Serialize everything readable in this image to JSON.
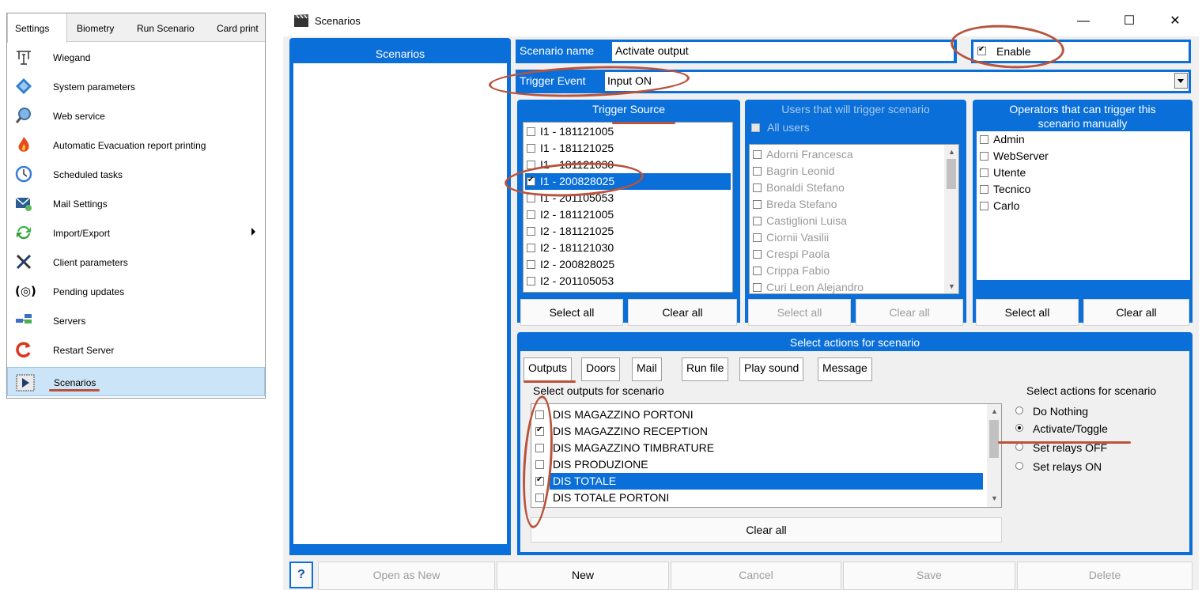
{
  "menu": {
    "tabs": [
      "Settings",
      "Biometry",
      "Run Scenario",
      "Card print"
    ],
    "items": [
      {
        "label": "Wiegand",
        "icon": "wiegand-icon"
      },
      {
        "label": "System parameters",
        "icon": "diamond-icon"
      },
      {
        "label": "Web service",
        "icon": "magnifier-globe-icon"
      },
      {
        "label": "Automatic Evacuation report printing",
        "icon": "flame-icon"
      },
      {
        "label": "Scheduled tasks",
        "icon": "clock-icon"
      },
      {
        "label": "Mail Settings",
        "icon": "mail-icon"
      },
      {
        "label": "Import/Export",
        "icon": "sync-arrows-icon"
      },
      {
        "label": "Client parameters",
        "icon": "tools-icon"
      },
      {
        "label": "Pending updates",
        "icon": "pending-icon"
      },
      {
        "label": "Servers",
        "icon": "servers-icon"
      },
      {
        "label": "Restart Server",
        "icon": "restart-icon"
      },
      {
        "label": "Scenarios",
        "icon": "play-icon"
      }
    ]
  },
  "window": {
    "title": "Scenarios",
    "controls": {
      "minimize": "—",
      "maximize": "☐",
      "close": "✕"
    }
  },
  "scenarios_panel": {
    "header": "Scenarios"
  },
  "scenario": {
    "name_label": "Scenario name",
    "name_value": "Activate output",
    "enable_label": "Enable",
    "trigger_event_label": "Trigger Event",
    "trigger_event_value": "Input ON"
  },
  "trigger_source": {
    "header": "Trigger Source",
    "items": [
      {
        "label": "I1 - 181121005",
        "checked": false
      },
      {
        "label": "I1 - 181121025",
        "checked": false
      },
      {
        "label": "I1 - 181121030",
        "checked": false
      },
      {
        "label": "I1 - 200828025",
        "checked": true
      },
      {
        "label": "I1 - 201105053",
        "checked": false
      },
      {
        "label": "I2 - 181121005",
        "checked": false
      },
      {
        "label": "I2 - 181121025",
        "checked": false
      },
      {
        "label": "I2 - 181121030",
        "checked": false
      },
      {
        "label": "I2 - 200828025",
        "checked": false
      },
      {
        "label": "I2 - 201105053",
        "checked": false
      }
    ],
    "select_all": "Select all",
    "clear_all": "Clear all"
  },
  "users": {
    "header": "Users that will trigger scenario",
    "all_users": "All users",
    "items": [
      "Adorni Francesca",
      "Bagrin Leonid",
      "Bonaldi Stefano",
      "Breda Stefano",
      "Castiglioni Luisa",
      "Ciornii Vasilii",
      "Crespi Paola",
      "Crippa Fabio",
      "Curi Leon Alejandro"
    ],
    "select_all": "Select all",
    "clear_all": "Clear all"
  },
  "operators": {
    "header_line1": "Operators that can trigger this",
    "header_line2": "scenario manually",
    "items": [
      "Admin",
      "WebServer",
      "Utente",
      "Tecnico",
      "Carlo"
    ],
    "select_all": "Select all",
    "clear_all": "Clear all"
  },
  "actions": {
    "header": "Select actions for scenario",
    "tabs": [
      "Outputs",
      "Doors",
      "Mail",
      "Run file",
      "Play sound",
      "Message"
    ],
    "outputs_label": "Select outputs for scenario",
    "outputs": [
      {
        "label": "DIS MAGAZZINO PORTONI",
        "checked": false
      },
      {
        "label": "DIS MAGAZZINO RECEPTION",
        "checked": true
      },
      {
        "label": "DIS MAGAZZINO TIMBRATURE",
        "checked": false
      },
      {
        "label": "DIS PRODUZIONE",
        "checked": false
      },
      {
        "label": "DIS TOTALE",
        "checked": true
      },
      {
        "label": "DIS TOTALE PORTONI",
        "checked": false
      }
    ],
    "clear_all": "Clear all",
    "radio_title": "Select actions for scenario",
    "radio_options": [
      "Do Nothing",
      "Activate/Toggle",
      "Set relays OFF",
      "Set relays ON"
    ],
    "radio_selected": 1
  },
  "footer": {
    "help": "?",
    "open_as_new": "Open as New",
    "new": "New",
    "cancel": "Cancel",
    "save": "Save",
    "delete": "Delete"
  },
  "colors": {
    "accent": "#0a6fd9",
    "annotation": "#b9533c",
    "menu_selected": "#cce4f7"
  }
}
